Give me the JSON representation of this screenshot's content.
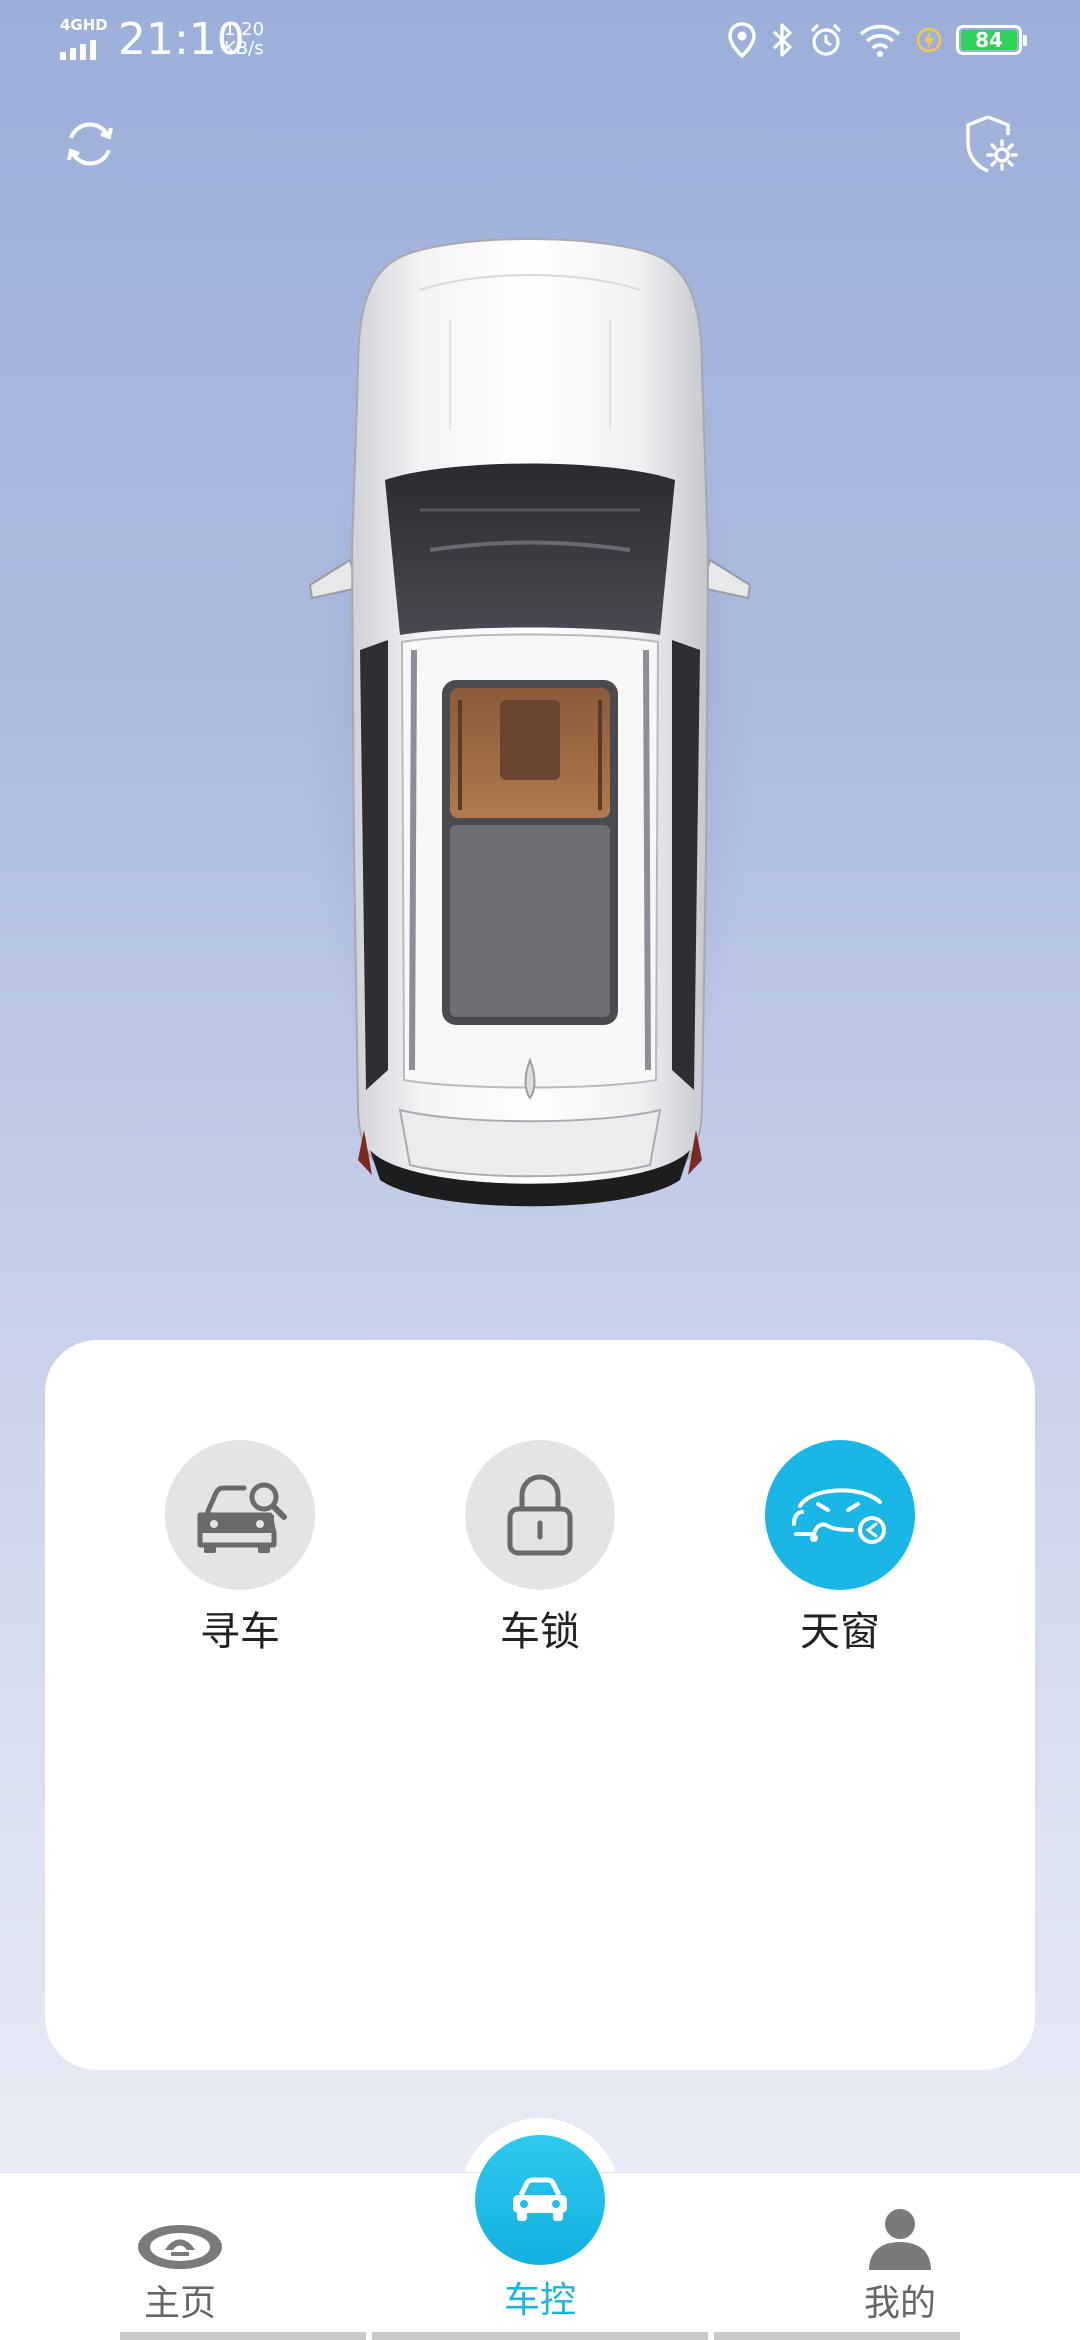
{
  "status_bar": {
    "network": "4GHD",
    "time": "21:10",
    "speed_value": "1.20",
    "speed_unit": "KB/s",
    "battery_level": "84",
    "icons": [
      "location-icon",
      "bluetooth-icon",
      "alarm-icon",
      "wifi-icon",
      "charging-icon"
    ]
  },
  "header": {
    "refresh_icon": "refresh-icon",
    "settings_icon": "shield-gear-icon"
  },
  "controls": [
    {
      "label": "寻车",
      "icon": "car-search-icon",
      "active": false
    },
    {
      "label": "车锁",
      "icon": "lock-icon",
      "active": false
    },
    {
      "label": "天窗",
      "icon": "sunroof-icon",
      "active": true
    }
  ],
  "nav": {
    "home_label": "主页",
    "control_label": "车控",
    "profile_label": "我的",
    "active": "车控"
  },
  "colors": {
    "accent": "#1ab6e5",
    "background_top": "#9cafd9",
    "background_bottom": "#eef0f7",
    "battery_green": "#2fd158"
  }
}
